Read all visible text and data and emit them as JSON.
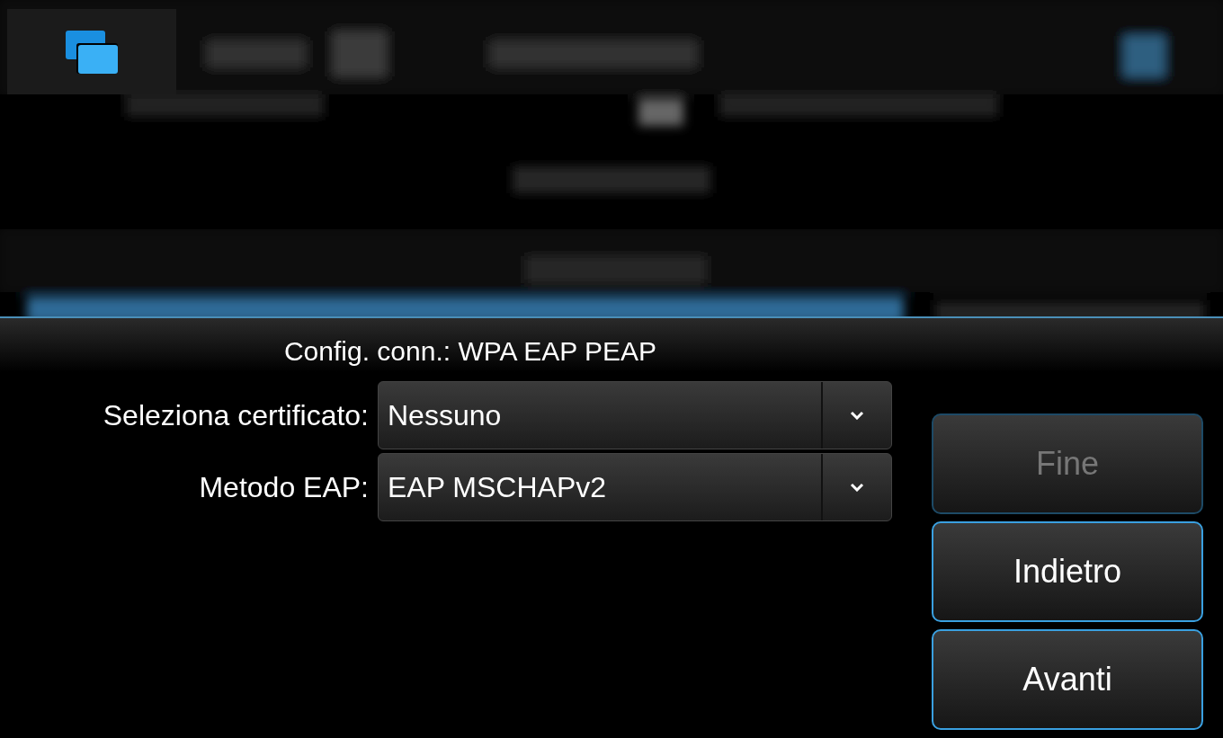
{
  "dialog": {
    "title": "Config. conn.: WPA EAP PEAP",
    "fields": [
      {
        "label": "Seleziona certificato:",
        "value": "Nessuno"
      },
      {
        "label": "Metodo EAP:",
        "value": "EAP MSCHAPv2"
      }
    ],
    "buttons": [
      {
        "label": "Fine",
        "disabled": true
      },
      {
        "label": "Indietro",
        "disabled": false
      },
      {
        "label": "Avanti",
        "disabled": false
      }
    ]
  }
}
